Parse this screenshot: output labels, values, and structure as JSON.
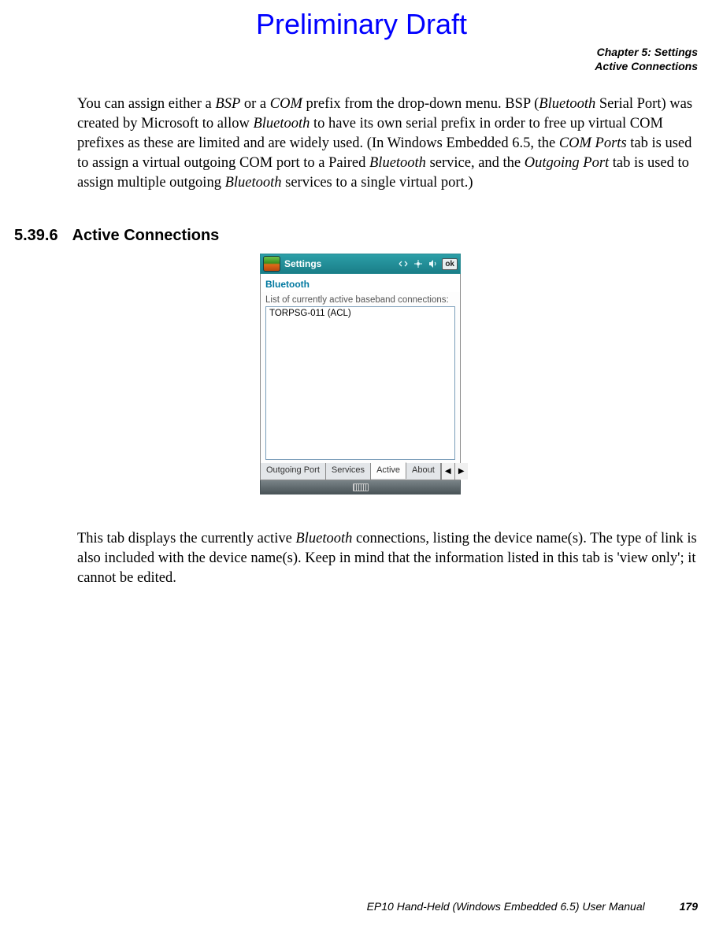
{
  "watermark": "Preliminary Draft",
  "header": {
    "chapter": "Chapter 5:  Settings",
    "section": "Active Connections"
  },
  "para1": {
    "t1": "You can assign either a ",
    "i1": "BSP",
    "t2": " or a ",
    "i2": "COM",
    "t3": " prefix from the drop-down menu. BSP (",
    "i3": "Bluetooth",
    "t4": " Serial Port) was created by Microsoft to allow ",
    "i4": "Bluetooth",
    "t5": " to have its own serial prefix in order to free up virtual COM prefixes as these are limited and are widely used. (In Windows Embedded 6.5, the ",
    "i5": "COM Ports",
    "t6": " tab is used to assign a virtual outgoing COM port to a Paired ",
    "i6": "Bluetooth",
    "t7": " service, and the ",
    "i7": "Outgoing Port",
    "t8": " tab is used to assign multiple outgoing ",
    "i8": "Bluetooth",
    "t9": " services to a single virtual port.)"
  },
  "heading": {
    "num": "5.39.6",
    "title": "Active Connections"
  },
  "screenshot": {
    "titlebar": "Settings",
    "ok": "ok",
    "panel_title": "Bluetooth",
    "list_caption": "List of currently active baseband connections:",
    "list_item": "TORPSG-011 (ACL)",
    "tabs": {
      "outgoing": "Outgoing Port",
      "services": "Services",
      "active": "Active",
      "about": "About"
    },
    "scroll_left": "◀",
    "scroll_right": "▶"
  },
  "para2": {
    "t1": "This tab displays the currently active ",
    "i1": "Bluetooth",
    "t2": " connections, listing the device name(s). The type of link is also included with the device name(s). Keep in mind that the information listed in this tab is 'view only'; it cannot be edited."
  },
  "footer": {
    "doc": "EP10 Hand-Held (Windows Embedded 6.5) User Manual",
    "page": "179"
  }
}
